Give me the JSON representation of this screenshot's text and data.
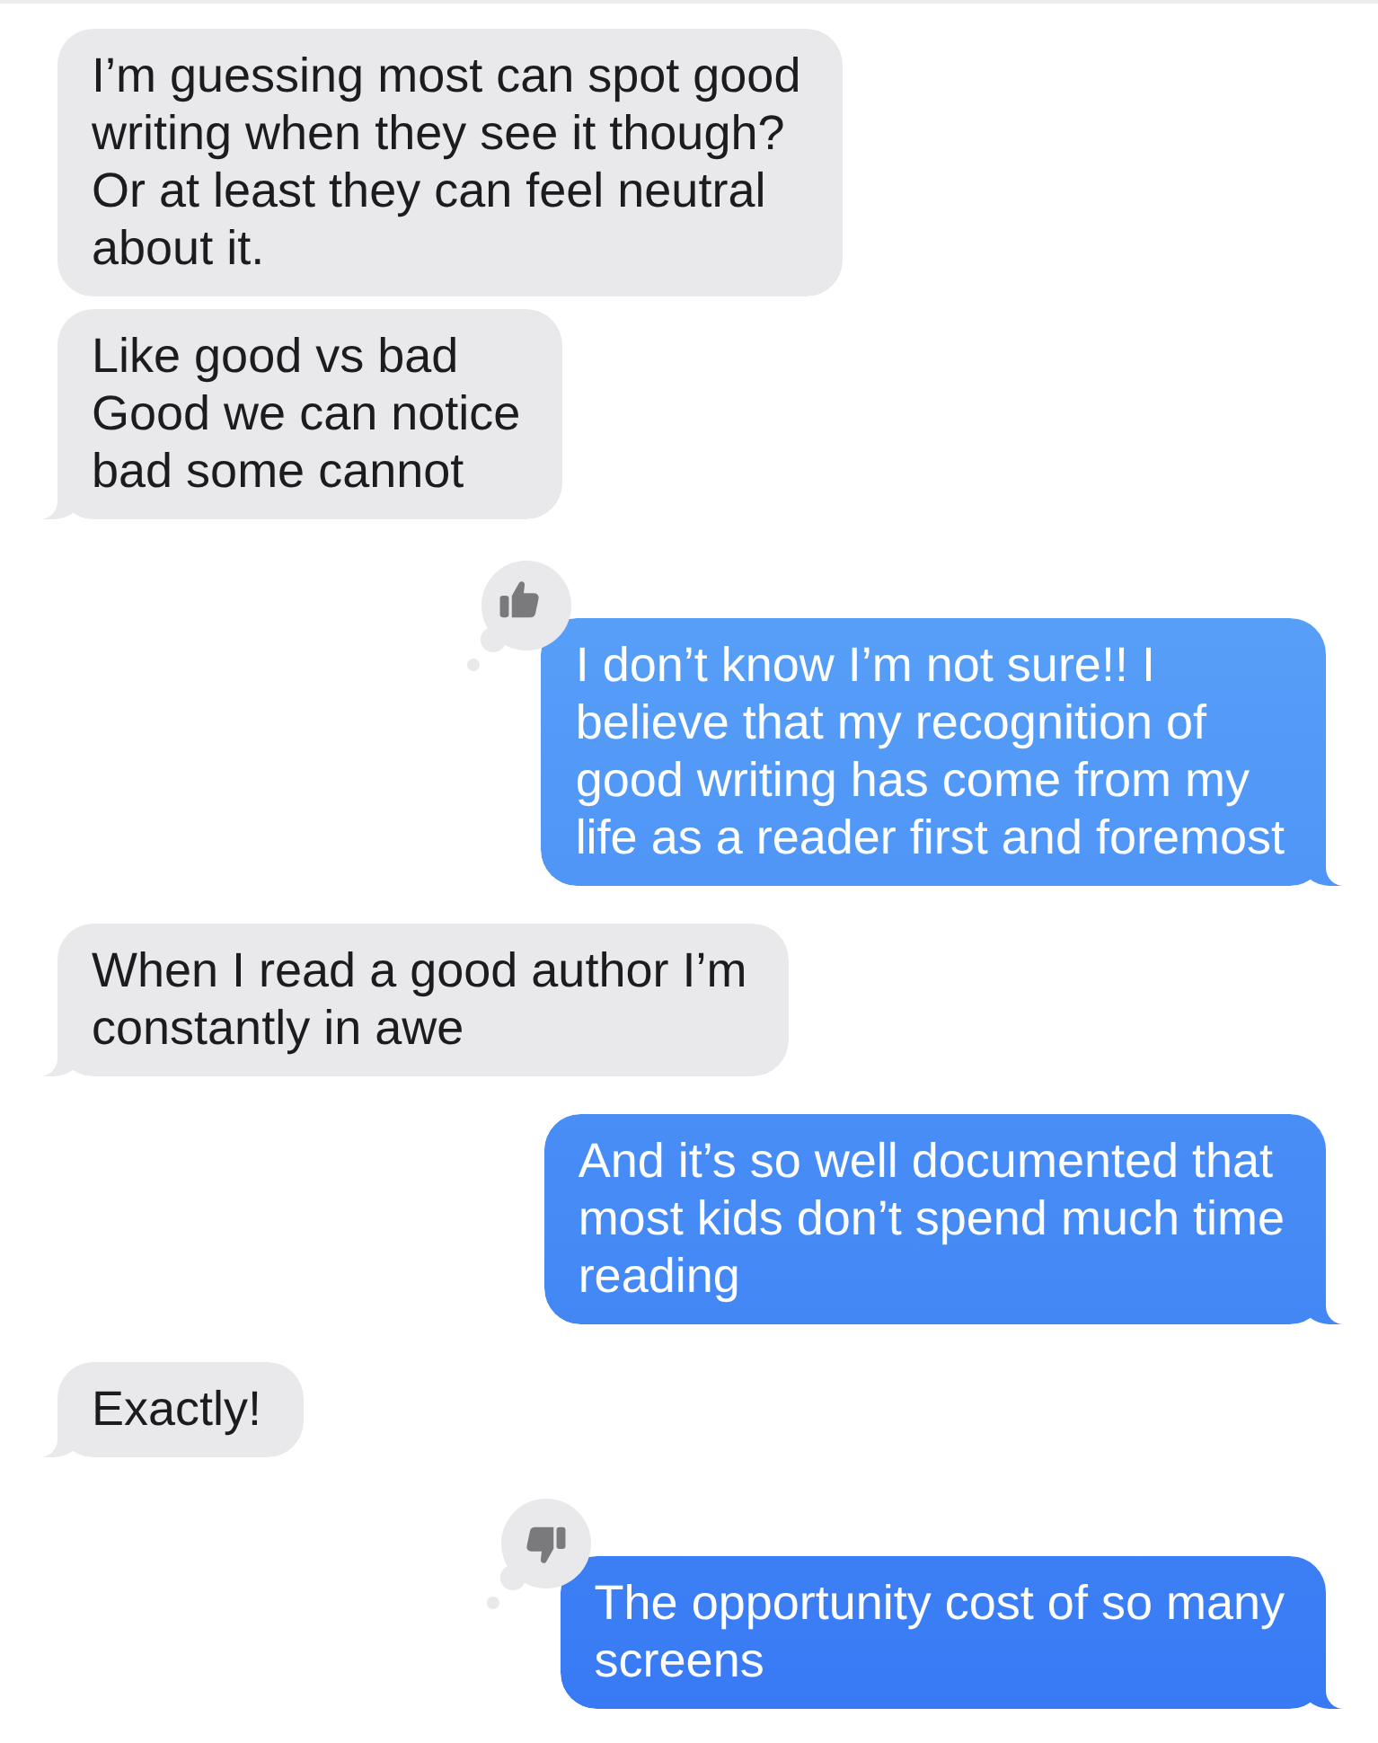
{
  "messages": [
    {
      "kind": "received",
      "text": "I’m guessing most can spot good\nwriting when they see it though?\nOr at least they can feel neutral\nabout it.",
      "tail": false
    },
    {
      "kind": "received",
      "text": "Like good vs bad\nGood we can notice\nbad some cannot",
      "tail": true
    },
    {
      "kind": "sent",
      "text": "I don’t know I’m not sure!! I\nbelieve that my recognition of\ngood writing has come from my\nlife as a reader first and foremost",
      "tail": true,
      "reaction": {
        "kind": "thumbs_up"
      }
    },
    {
      "kind": "received",
      "text": "When I read a good author I’m\nconstantly in awe",
      "tail": true
    },
    {
      "kind": "sent",
      "text": "And it’s so well documented that\nmost kids don’t spend much time\nreading",
      "tail": true
    },
    {
      "kind": "received",
      "text": "Exactly!",
      "tail": true
    },
    {
      "kind": "sent",
      "text": "The opportunity cost of so many\nscreens",
      "tail": true,
      "reaction": {
        "kind": "thumbs_down"
      }
    }
  ]
}
